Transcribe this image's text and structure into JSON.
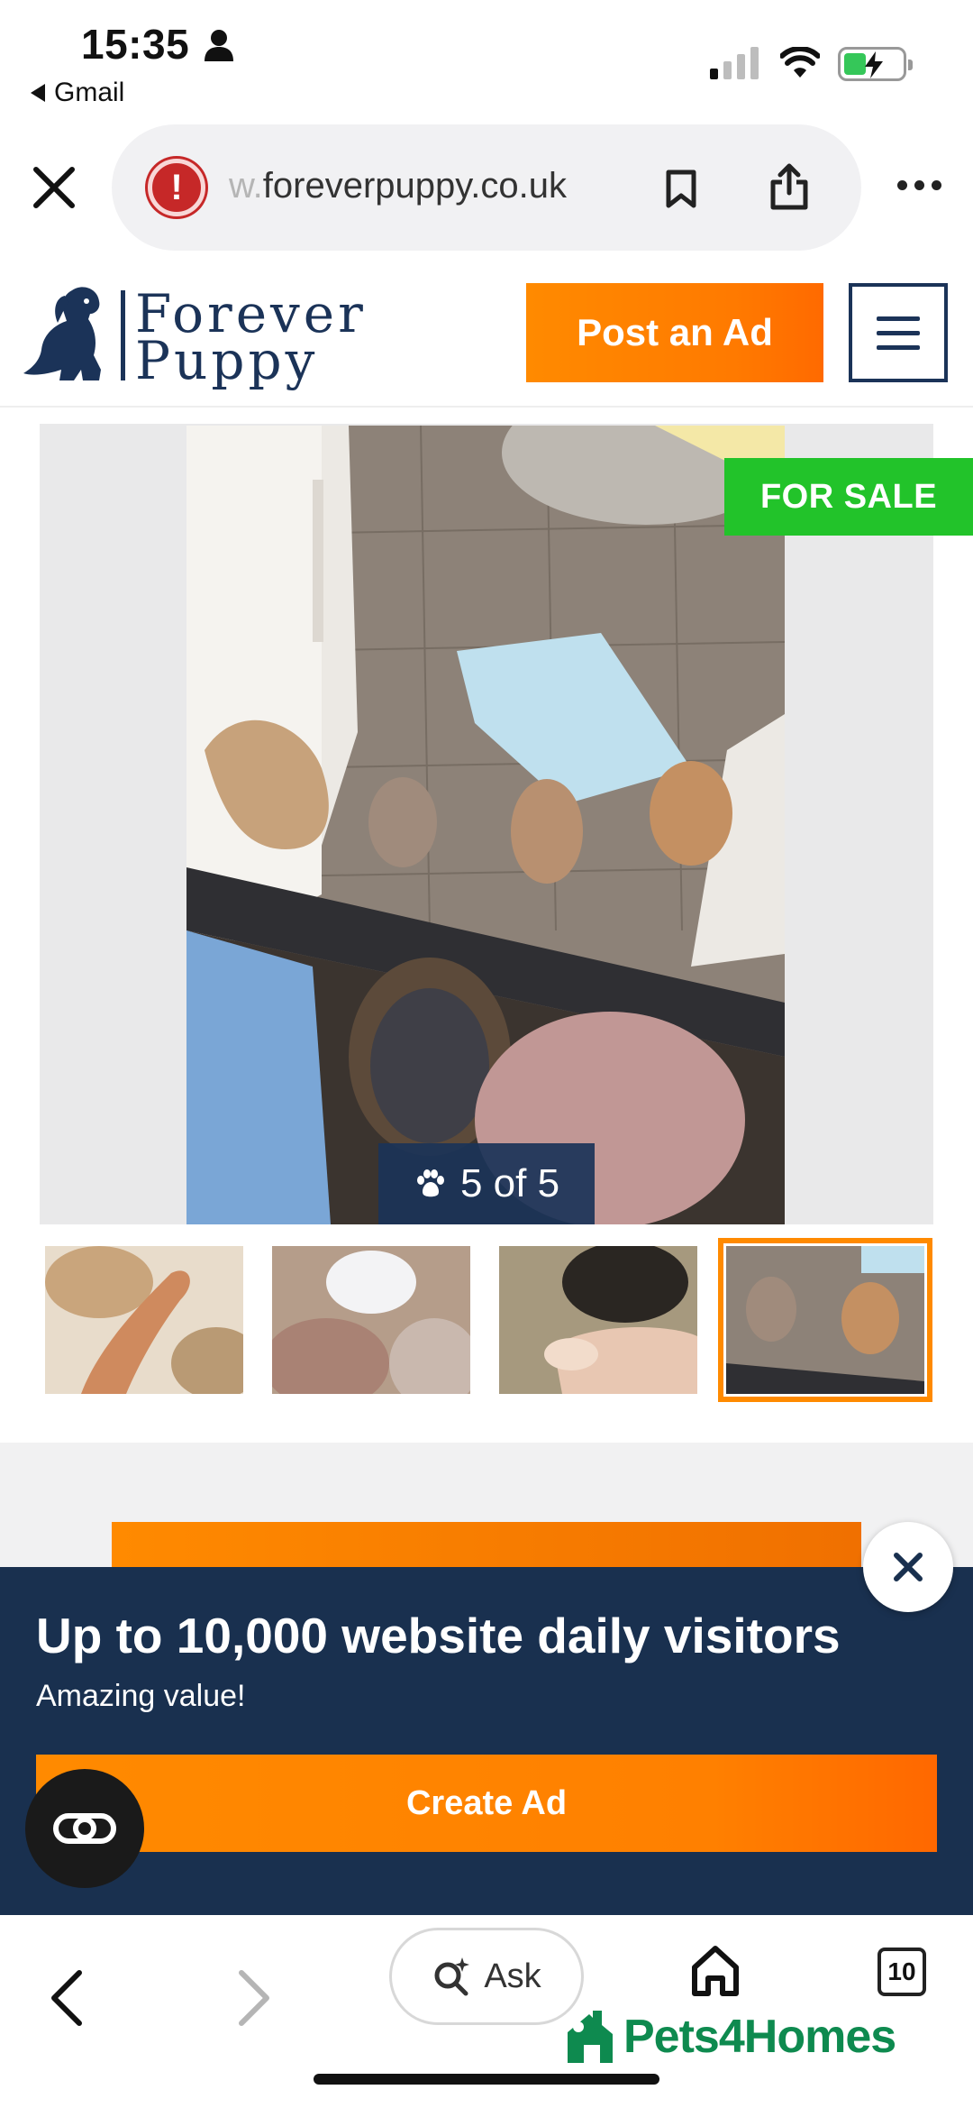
{
  "status_bar": {
    "time": "15:35",
    "back_app": "Gmail",
    "icons": [
      "person-icon",
      "signal-icon",
      "wifi-icon",
      "battery-charging-icon"
    ]
  },
  "browser": {
    "url_faded": "w.",
    "url_main": "foreverpuppy.co.uk",
    "icons": [
      "close-icon",
      "alert-icon",
      "bookmark-icon",
      "share-icon",
      "more-icon"
    ]
  },
  "site_header": {
    "logo_line1": "Forever",
    "logo_line2": "Puppy",
    "post_ad_label": "Post an Ad",
    "colors": {
      "navy": "#1b3358",
      "orange": "#ff8a00"
    }
  },
  "gallery": {
    "badge": "FOR SALE",
    "counter_text": "5 of 5",
    "thumbnails_active_index": 3,
    "badge_color": "#22c32a"
  },
  "promo": {
    "title": "Up to 10,000 website daily visitors",
    "subtitle": "Amazing value!",
    "cta_label": "Create Ad",
    "background": "#19304f"
  },
  "bottom_nav": {
    "ask_label": "Ask",
    "tab_count": "10",
    "brand": "Pets4Homes",
    "brand_color": "#0e8a4f"
  }
}
